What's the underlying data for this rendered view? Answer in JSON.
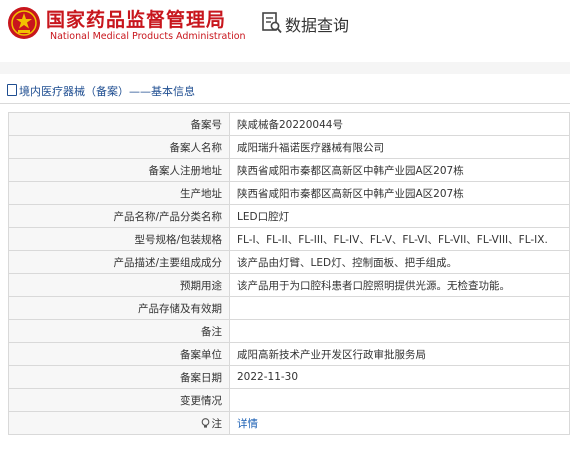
{
  "header": {
    "title_cn": "国家药品监督管理局",
    "title_en": "National Medical Products Administration",
    "page_heading": "数据查询",
    "emblem_icon": "national-emblem-icon",
    "heading_icon": "document-search-icon"
  },
  "section": {
    "title": "境内医疗器械（备案）——基本信息",
    "icon": "document-icon"
  },
  "colors": {
    "brand_red": "#c8161d",
    "section_blue": "#1f4e91",
    "link_blue": "#1a5fb4",
    "label_bg": "#f7f7f7",
    "border": "#d9d9d9"
  },
  "rows": [
    {
      "label": "备案号",
      "value": "陕咸械备20220044号"
    },
    {
      "label": "备案人名称",
      "value": "咸阳瑞升福诺医疗器械有限公司"
    },
    {
      "label": "备案人注册地址",
      "value": "陕西省咸阳市秦都区高新区中韩产业园A区207栋"
    },
    {
      "label": "生产地址",
      "value": "陕西省咸阳市秦都区高新区中韩产业园A区207栋"
    },
    {
      "label": "产品名称/产品分类名称",
      "value": "LED口腔灯"
    },
    {
      "label": "型号规格/包装规格",
      "value": "FL-I、FL-II、FL-III、FL-IV、FL-V、FL-VI、FL-VII、FL-VIII、FL-IX."
    },
    {
      "label": "产品描述/主要组成成分",
      "value": "该产品由灯臂、LED灯、控制面板、把手组成。"
    },
    {
      "label": "预期用途",
      "value": "该产品用于为口腔科患者口腔照明提供光源。无检查功能。"
    },
    {
      "label": "产品存储及有效期",
      "value": ""
    },
    {
      "label": "备注",
      "value": ""
    },
    {
      "label": "备案单位",
      "value": "咸阳高新技术产业开发区行政审批服务局"
    },
    {
      "label": "备案日期",
      "value": "2022-11-30"
    },
    {
      "label": "变更情况",
      "value": ""
    },
    {
      "label": "注",
      "value": "详情",
      "icon": "lightbulb-icon"
    }
  ]
}
